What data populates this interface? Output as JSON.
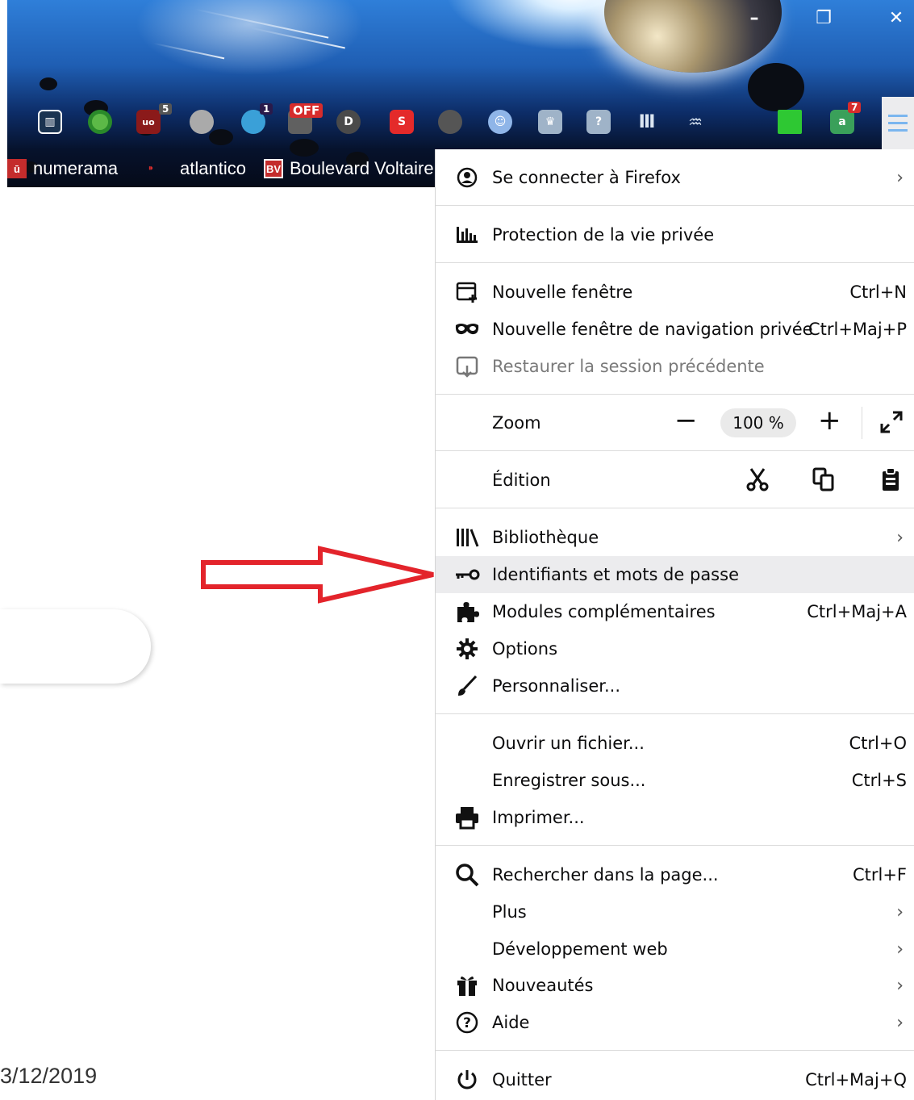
{
  "window_controls": {
    "minimize": "–",
    "restore": "❐",
    "close": "✕"
  },
  "toolbar": {
    "badges": {
      "ublock": "5",
      "counter": "1",
      "off": "OFF",
      "amazon": "7"
    }
  },
  "bookmarks": [
    {
      "label": "numerama"
    },
    {
      "label": "atlantico"
    },
    {
      "label": "Boulevard Voltaire"
    }
  ],
  "menu": {
    "sign_in": "Se connecter à Firefox",
    "privacy": "Protection de la vie privée",
    "new_window": {
      "label": "Nouvelle fenêtre",
      "shortcut": "Ctrl+N"
    },
    "private_window": {
      "label": "Nouvelle fenêtre de navigation privée",
      "shortcut": "Ctrl+Maj+P"
    },
    "restore_session": "Restaurer la session précédente",
    "zoom": {
      "label": "Zoom",
      "value": "100 %"
    },
    "edit": {
      "label": "Édition"
    },
    "library": "Bibliothèque",
    "logins": "Identifiants et mots de passe",
    "addons": {
      "label": "Modules complémentaires",
      "shortcut": "Ctrl+Maj+A"
    },
    "options": "Options",
    "customize": "Personnaliser...",
    "open_file": {
      "label": "Ouvrir un fichier...",
      "shortcut": "Ctrl+O"
    },
    "save_as": {
      "label": "Enregistrer sous...",
      "shortcut": "Ctrl+S"
    },
    "print": "Imprimer...",
    "find": {
      "label": "Rechercher dans la page...",
      "shortcut": "Ctrl+F"
    },
    "more": "Plus",
    "webdev": "Développement web",
    "whatsnew": "Nouveautés",
    "help": "Aide",
    "quit": {
      "label": "Quitter",
      "shortcut": "Ctrl+Maj+Q"
    }
  },
  "footer_date": "3/12/2019",
  "colors": {
    "arrow": "#e3242b",
    "hover": "#ececee"
  }
}
